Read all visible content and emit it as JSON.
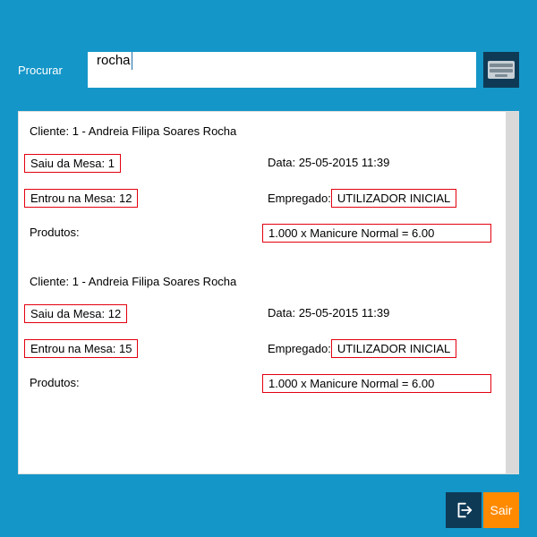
{
  "search": {
    "label": "Procurar",
    "value": "rocha"
  },
  "labels": {
    "cliente": "Cliente:",
    "saiu": "Saiu da Mesa:",
    "entrou": "Entrou na Mesa:",
    "data": "Data:",
    "empregado": "Empregado:",
    "produtos": "Produtos:"
  },
  "entries": [
    {
      "cliente_id": "1",
      "cliente_nome": "Andreia Filipa Soares Rocha",
      "saiu_mesa": "1",
      "entrou_mesa": "12",
      "data": "25-05-2015 11:39",
      "empregado": "UTILIZADOR INICIAL",
      "produto": "1.000 x Manicure Normal = 6.00"
    },
    {
      "cliente_id": "1",
      "cliente_nome": "Andreia Filipa Soares Rocha",
      "saiu_mesa": "12",
      "entrou_mesa": "15",
      "data": "25-05-2015 11:39",
      "empregado": "UTILIZADOR INICIAL",
      "produto": "1.000 x Manicure Normal = 6.00"
    }
  ],
  "footer": {
    "exit": "Sair"
  },
  "colors": {
    "brand": "#1496C8",
    "highlight": "#E3000F",
    "orange": "#FF8A00",
    "darknavy": "#0f3a56"
  }
}
